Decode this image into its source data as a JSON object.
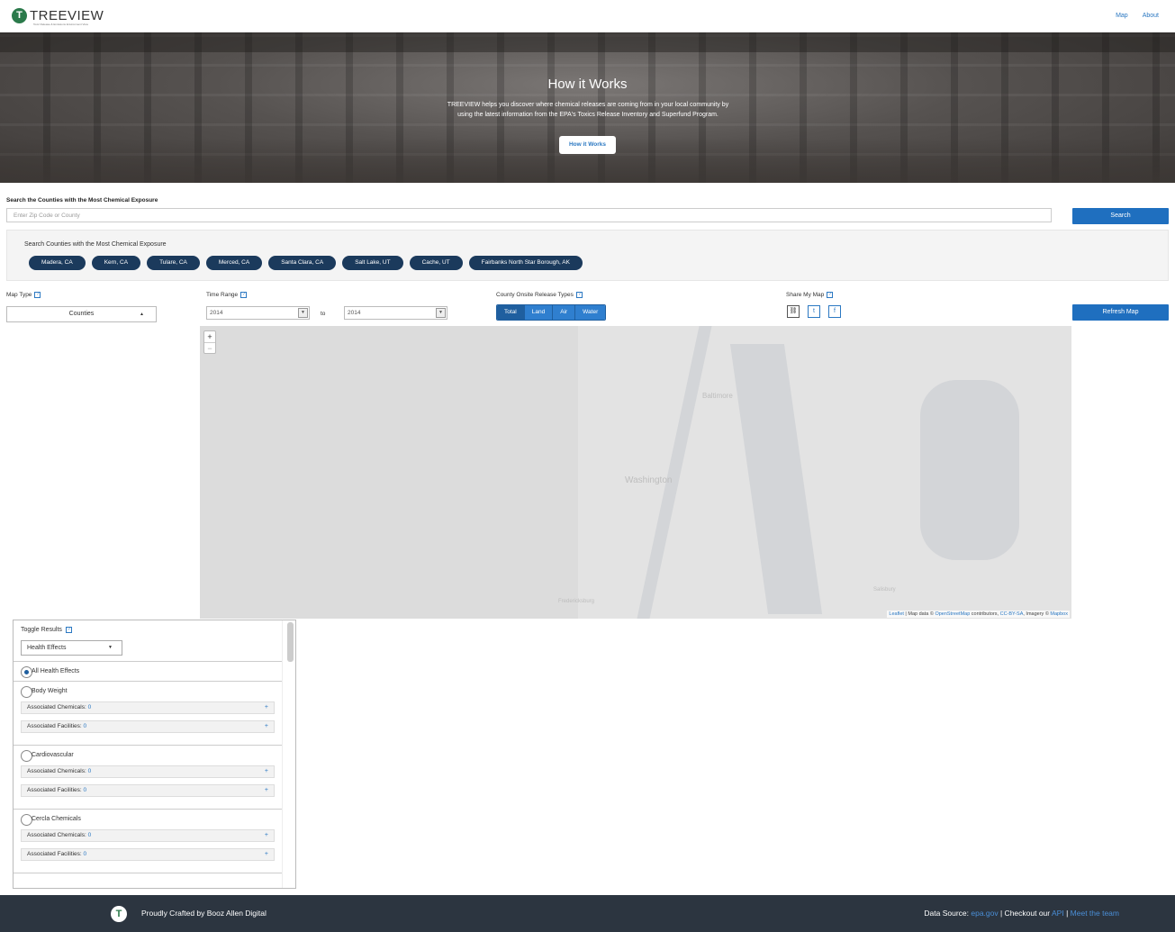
{
  "brand": {
    "name": "TREEVIEW",
    "tagline": "Toxic Release & Emissions Environment View",
    "mark": "T"
  },
  "nav": {
    "items": [
      "Map",
      "About"
    ]
  },
  "hero": {
    "title": "How it Works",
    "text": "TREEVIEW helps you discover where chemical releases are coming from in your local community by using the latest information from the EPA's Toxics Release Inventory and Superfund Program.",
    "button": "How it Works"
  },
  "search": {
    "label": "Search the Counties with the Most Chemical Exposure",
    "placeholder": "Enter Zip Code or County",
    "button": "Search"
  },
  "counties": {
    "title": "Search Counties with the Most Chemical Exposure",
    "items": [
      "Madera, CA",
      "Kern, CA",
      "Tulare, CA",
      "Merced, CA",
      "Santa Clara, CA",
      "Salt Lake, UT",
      "Cache, UT",
      "Fairbanks North Star Borough, AK"
    ]
  },
  "controls": {
    "map_type": {
      "label": "Map Type",
      "value": "Counties"
    },
    "time_range": {
      "label": "Time Range",
      "from": "2014",
      "to": "2014",
      "to_label": "to"
    },
    "release_types": {
      "label": "County Onsite Release Types",
      "options": [
        "Total",
        "Land",
        "Air",
        "Water"
      ],
      "selected": "Total"
    },
    "share": {
      "label": "Share My Map"
    },
    "refresh": "Refresh Map"
  },
  "map": {
    "zoom_in": "+",
    "zoom_out": "−",
    "cities": [
      "Baltimore",
      "Washington",
      "Fredericksburg",
      "Salisbury"
    ],
    "attribution": {
      "leaflet": "Leaflet",
      "t1": " | Map data © ",
      "osm": "OpenStreetMap",
      "t2": " contributors, ",
      "cc": "CC-BY-SA",
      "t3": ", Imagery © ",
      "mapbox": "Mapbox"
    }
  },
  "results": {
    "title": "Toggle Results",
    "select": "Health Effects",
    "all": "All Health Effects",
    "effects": [
      {
        "name": "Body Weight",
        "chem_label": "Associated Chemicals:",
        "chem": "0",
        "fac_label": "Associated Facilities:",
        "fac": "0"
      },
      {
        "name": "Cardiovascular",
        "chem_label": "Associated Chemicals:",
        "chem": "0",
        "fac_label": "Associated Facilities:",
        "fac": "0"
      },
      {
        "name": "Cercla Chemicals",
        "chem_label": "Associated Chemicals:",
        "chem": "0",
        "fac_label": "Associated Facilities:",
        "fac": "0"
      }
    ],
    "expand": "+"
  },
  "footer": {
    "crafted": "Proudly Crafted by Booz Allen Digital",
    "source_label": "Data Source: ",
    "source": "epa.gov",
    "sep1": " | Checkout our ",
    "api": "API",
    "sep2": " | ",
    "team": "Meet the team"
  },
  "colors": {
    "primary": "#1f6fbf",
    "pill": "#1b3a5c",
    "footer": "#2c3540",
    "brand_green": "#2b7a4b"
  }
}
